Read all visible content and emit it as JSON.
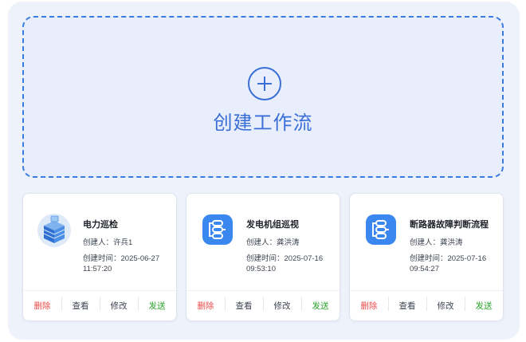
{
  "create": {
    "label": "创建工作流"
  },
  "labels": {
    "creator_prefix": "创建人：",
    "time_prefix": "创建时间："
  },
  "actions": {
    "delete": "删除",
    "view": "查看",
    "edit": "修改",
    "send": "发送"
  },
  "workflows": [
    {
      "title": "电力巡检",
      "creator": "许兵1",
      "created": "2025-06-27 11:57:20",
      "icon": "server-rack-icon"
    },
    {
      "title": "发电机组巡视",
      "creator": "龚洪涛",
      "created": "2025-07-16 09:53:10",
      "icon": "workflow-icon"
    },
    {
      "title": "断路器故障判断流程",
      "creator": "龚洪涛",
      "created": "2025-07-16 09:54:27",
      "icon": "workflow-icon"
    }
  ],
  "colors": {
    "accent": "#3a6fd8",
    "delete": "#e84a4a",
    "send": "#2aa32a",
    "icon_blue": "#3b87f0"
  }
}
